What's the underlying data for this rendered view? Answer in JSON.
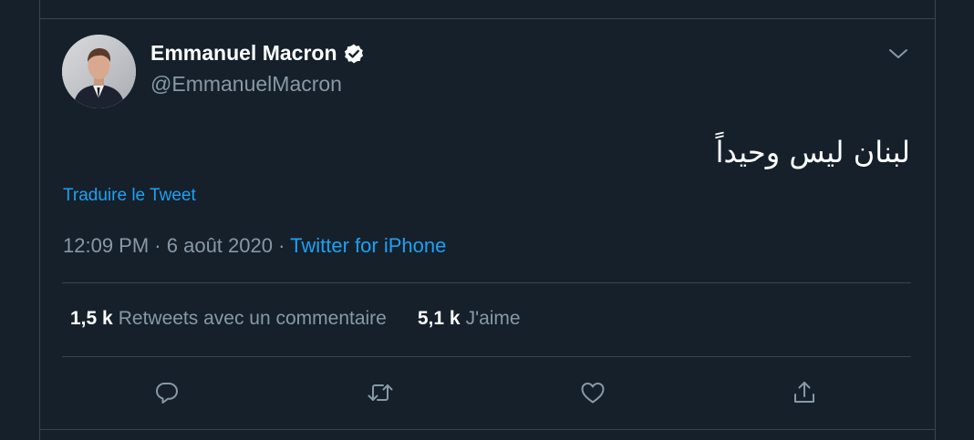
{
  "colors": {
    "background": "#15202b",
    "border": "#38444d",
    "text_primary": "#ffffff",
    "text_secondary": "#8899a6",
    "accent": "#1da1f2"
  },
  "tweet": {
    "author_name": "Emmanuel Macron",
    "author_handle": "@EmmanuelMacron",
    "verified_icon": "verified-badge-icon",
    "body": "لبنان ليس وحيداً",
    "translate_label": "Traduire le Tweet",
    "time": "12:09 PM",
    "date": "6 août 2020",
    "separator": "·",
    "source": "Twitter for iPhone"
  },
  "stats": {
    "retweets_count": "1,5 k",
    "retweets_label": "Retweets avec un commentaire",
    "likes_count": "5,1 k",
    "likes_label": "J'aime"
  },
  "actions": [
    {
      "icon": "reply-icon"
    },
    {
      "icon": "retweet-icon"
    },
    {
      "icon": "like-icon"
    },
    {
      "icon": "share-icon"
    }
  ]
}
